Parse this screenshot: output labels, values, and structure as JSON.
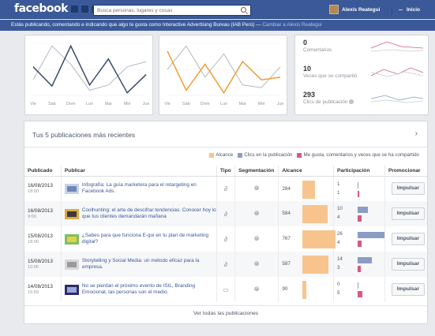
{
  "topbar": {
    "logo": "facebook",
    "search_placeholder": "Busca personas, lugares y cosas",
    "user_name": "Alexis Reategui",
    "home": "Inicio"
  },
  "notice": {
    "text": "Estás publicando, comentando e indicando que algo te gusta como Interactive Advertising Bureau (IAB Perú) — ",
    "link": "Cambiar a Alexis Reategui"
  },
  "charts": {
    "days": [
      "Vie",
      "Sáb",
      "Dom",
      "Lun",
      "Mar",
      "Mié",
      "Jue"
    ],
    "chart1": {
      "series": [
        {
          "color": "#3b4b6b",
          "values": [
            0.55,
            0.18,
            0.95,
            0.2,
            0.7,
            0.05,
            0.4
          ]
        },
        {
          "color": "#b5b8c0",
          "values": [
            0.3,
            0.95,
            0.6,
            0.1,
            0.2,
            0.55,
            0.65
          ]
        }
      ]
    },
    "chart2": {
      "series": [
        {
          "color": "#f39c33",
          "values": [
            0.85,
            0.1,
            0.6,
            0.05,
            0.65,
            0.3,
            0.35
          ]
        },
        {
          "color": "#b5b8c0",
          "values": [
            0.5,
            0.95,
            0.35,
            0.8,
            0.2,
            0.15,
            0.55
          ]
        }
      ]
    }
  },
  "stats": [
    {
      "num": "0",
      "label": "Comentarios"
    },
    {
      "num": "10",
      "label": "Veces que se compartió"
    },
    {
      "num": "293",
      "label": "Clics de publicación"
    }
  ],
  "posts": {
    "title": "Tus 5 publicaciones más recientes",
    "legend": {
      "reach": "Alcance",
      "clicks": "Clics en la publicación",
      "likes": "Me gusta, comentarios y veces que se ha compartido"
    },
    "colors": {
      "reach": "#f8c48d",
      "clicks": "#8b9dc3",
      "likes": "#d45a82"
    },
    "headers": [
      "Publicado",
      "Publicar",
      "Tipo",
      "Segmentación",
      "Alcance",
      "Participación",
      "Promocionar"
    ],
    "rows": [
      {
        "date": "16/08/2013",
        "time": "18:00",
        "text": "Infografía: La guía marketera para el retargeting en Facebook Ads.",
        "type": "link",
        "reach": "284",
        "reach_frac": 0.37,
        "clicks": "1",
        "likes": "1",
        "clicks_frac": 0.02,
        "likes_frac": 0.02,
        "button": "Impulsar"
      },
      {
        "date": "16/08/2013",
        "time": "9:00",
        "text": "Coolhunting: el arte de descifrar tendencias. Conocer hoy lo que tus clientes demandarán mañana",
        "type": "link",
        "reach": "584",
        "reach_frac": 0.76,
        "clicks": "10",
        "likes": "4",
        "clicks_frac": 0.38,
        "likes_frac": 0.15,
        "button": "Impulsar"
      },
      {
        "date": "15/08/2013",
        "time": "18:00",
        "text": "¿Sabes para que funciona E-goi en tu plan de marketing digital?",
        "type": "link",
        "reach": "767",
        "reach_frac": 1.0,
        "clicks": "26",
        "likes": "4",
        "clicks_frac": 1.0,
        "likes_frac": 0.15,
        "button": "Impulsar"
      },
      {
        "date": "15/08/2013",
        "time": "10:05",
        "text": "Storytelling y Social Media: un método eficaz para la empresa.",
        "type": "link",
        "reach": "587",
        "reach_frac": 0.77,
        "clicks": "14",
        "likes": "3",
        "clicks_frac": 0.54,
        "likes_frac": 0.12,
        "button": "Impulsar"
      },
      {
        "date": "14/08/2013",
        "time": "15:59",
        "text": "No se pierdan el próximo evento de ISIL, Branding Emocional, las personas son el medio.",
        "type": "event",
        "reach": "90",
        "reach_frac": 0.12,
        "clicks": "0",
        "likes": "5",
        "clicks_frac": 0.0,
        "likes_frac": 0.19,
        "button": "Impulsar"
      }
    ],
    "footer_link": "Ver todas las publicaciones"
  }
}
